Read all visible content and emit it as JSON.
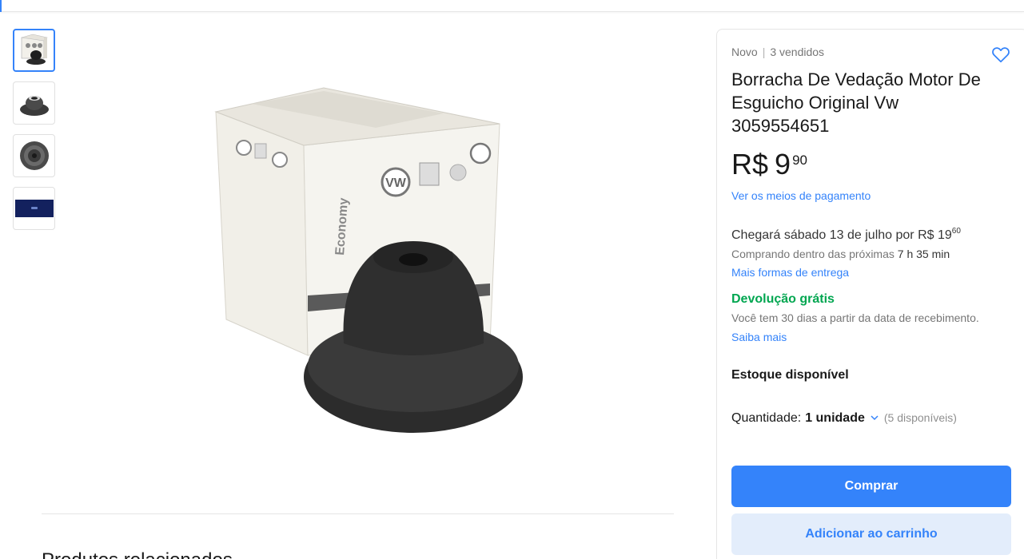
{
  "gallery": {
    "thumbnails": [
      {
        "icon": "product-box-thumbnail"
      },
      {
        "icon": "rubber-seal-side-thumbnail"
      },
      {
        "icon": "rubber-seal-top-thumbnail"
      },
      {
        "icon": "brand-banner-thumbnail"
      }
    ],
    "main_image": {
      "icon": "product-photo-box-and-seal"
    }
  },
  "related": {
    "title": "Produtos relacionados"
  },
  "product": {
    "condition": "Novo",
    "sold": "3 vendidos",
    "title": "Borracha De Vedação Motor De Esguicho Original Vw 3059554651",
    "price": {
      "currency": "R$",
      "integer": "9",
      "cents": "90"
    },
    "payment_link": "Ver os meios de pagamento"
  },
  "shipping": {
    "arrival_text": "Chegará sábado 13 de julho por R$ 19",
    "arrival_cents": "60",
    "buy_within_text": "Comprando dentro das próximas",
    "buy_within_time": "7 h 35 min",
    "more_link": "Mais formas de entrega"
  },
  "returns": {
    "title": "Devolução grátis",
    "subtitle": "Você tem 30 dias a partir da data de recebimento.",
    "link": "Saiba mais"
  },
  "stock": {
    "label": "Estoque disponível"
  },
  "quantity": {
    "label": "Quantidade:",
    "value": "1 unidade",
    "available": "(5 disponíveis)"
  },
  "actions": {
    "buy": "Comprar",
    "add_to_cart": "Adicionar ao carrinho"
  },
  "colors": {
    "accent": "#3483fa",
    "success": "#00a650",
    "secondary_button": "#e3edfb"
  }
}
